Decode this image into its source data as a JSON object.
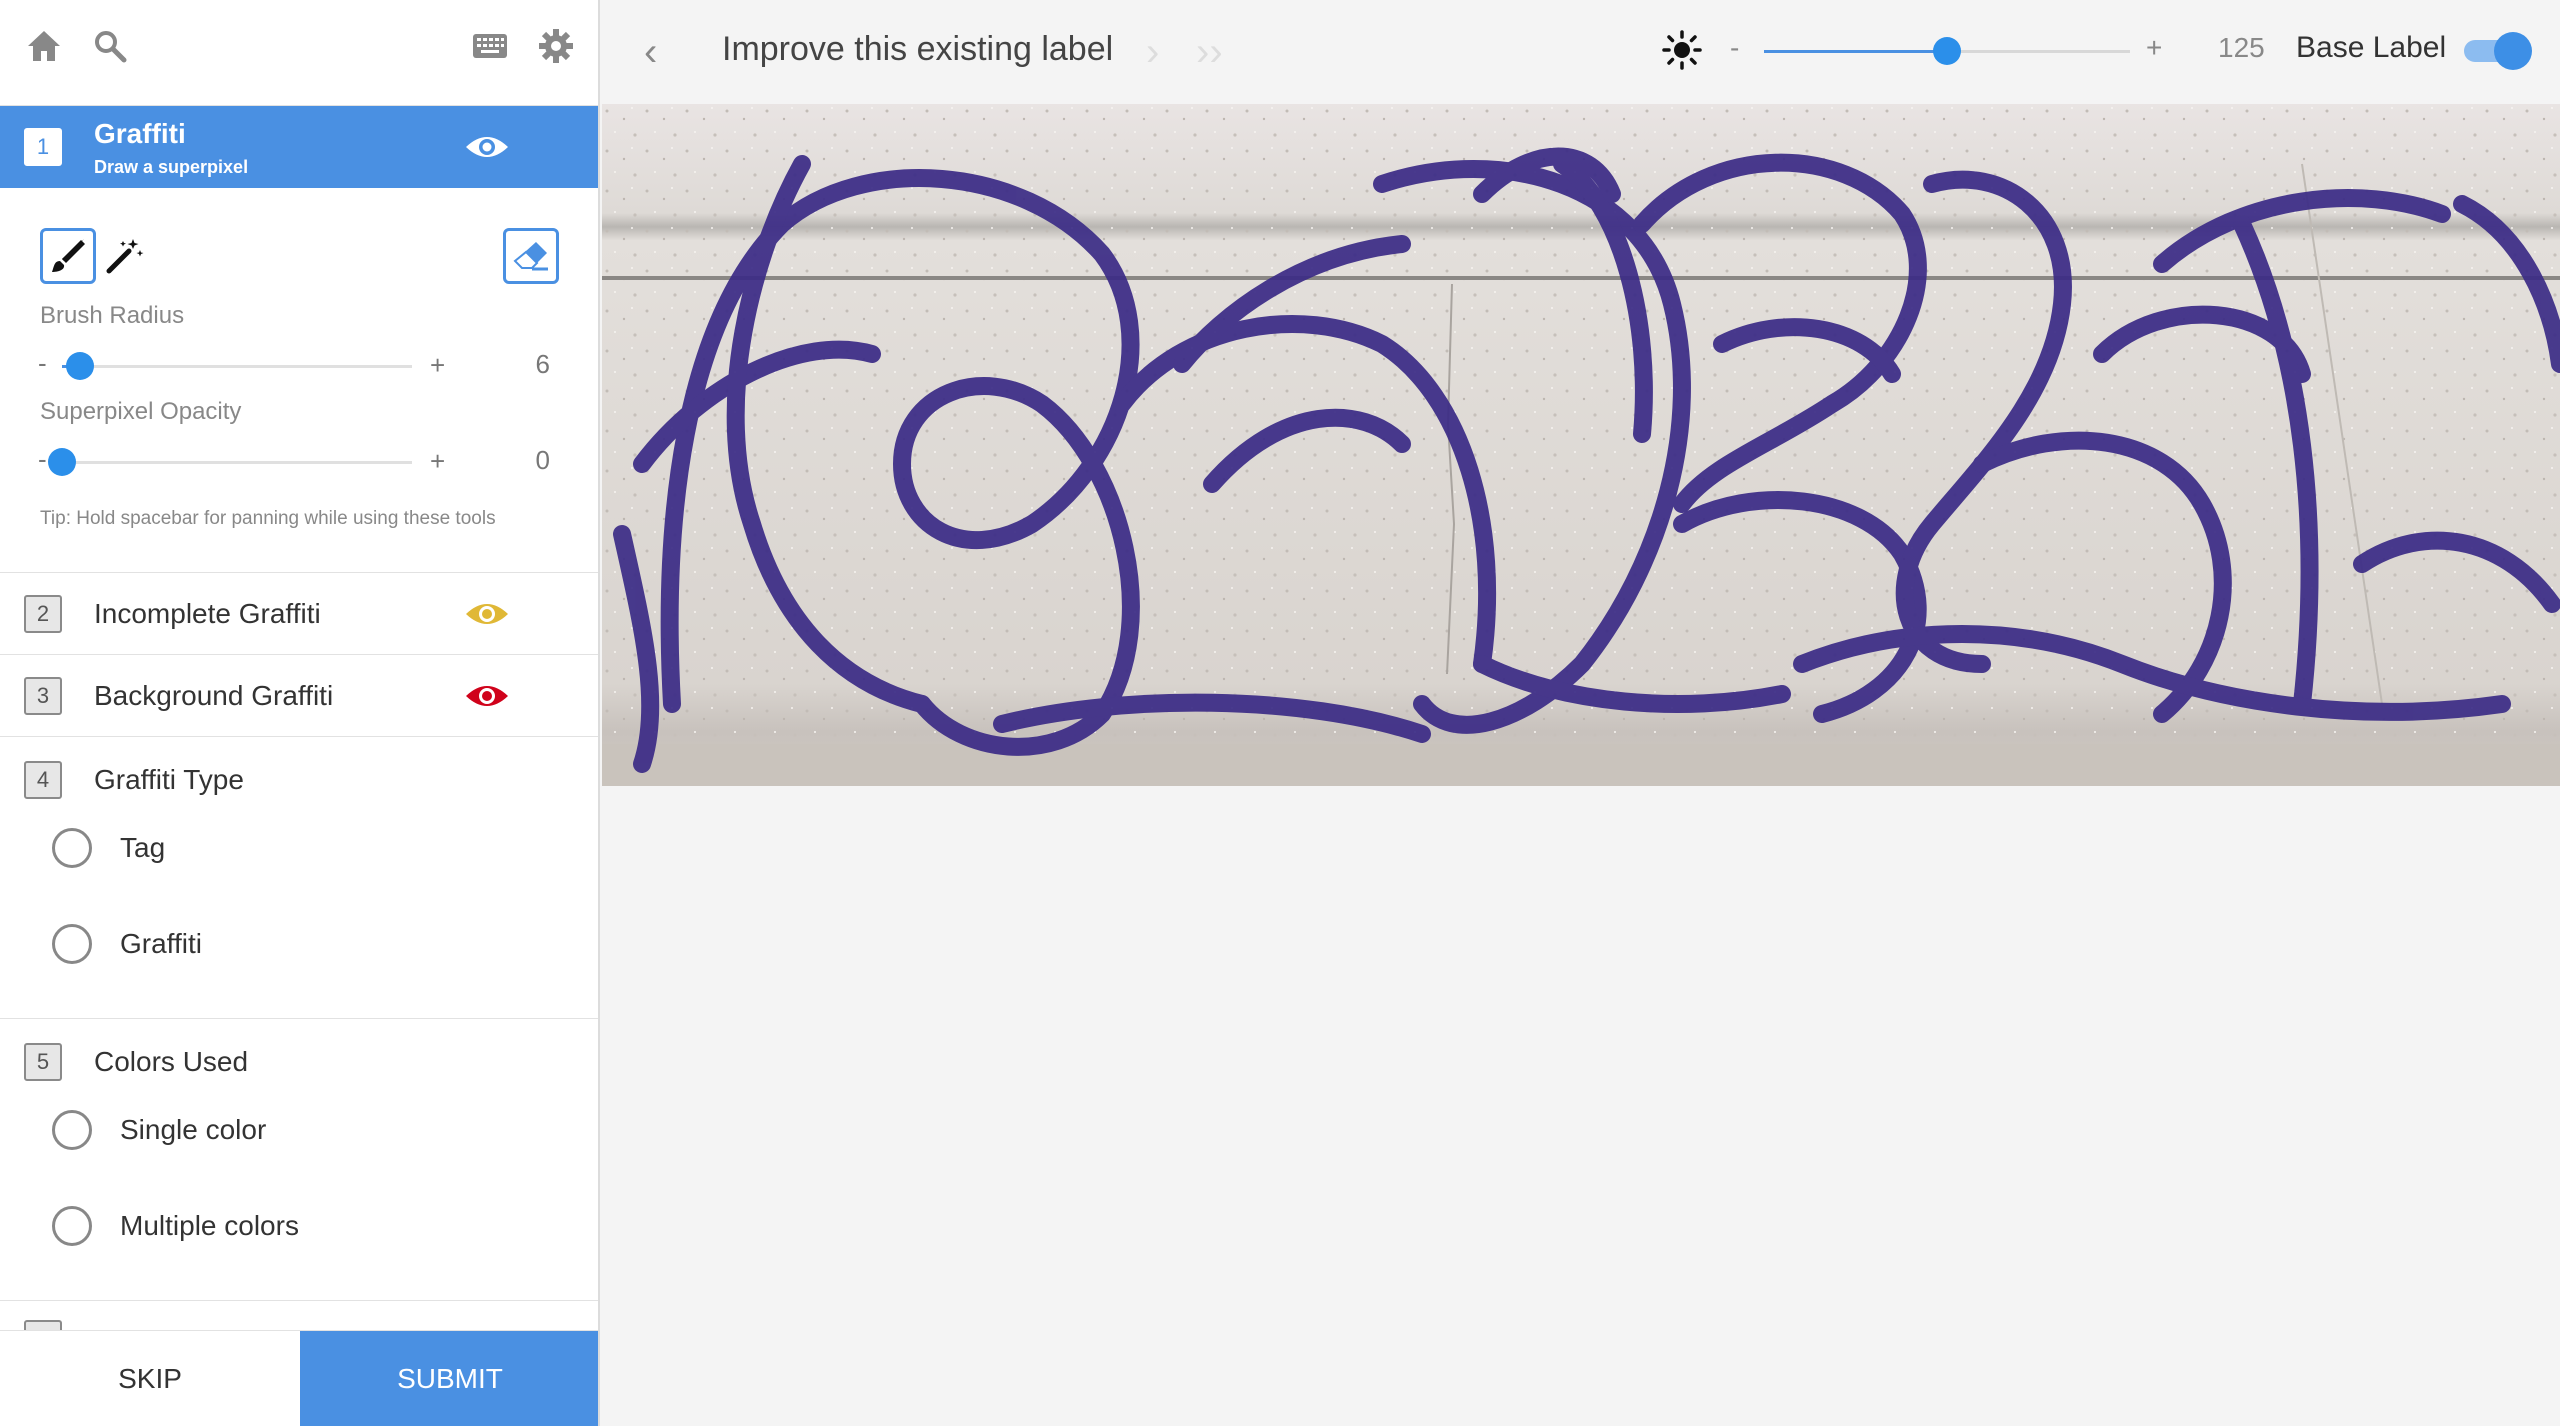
{
  "sidebar": {
    "home_icon": "home-icon",
    "search_icon": "search-icon",
    "keyboard_icon": "keyboard-icon",
    "settings_icon": "gear-icon",
    "active_label": {
      "number": "1",
      "name": "Graffiti",
      "subtitle": "Draw a superpixel",
      "eye_color": "#ffffff"
    },
    "tools": {
      "brush_icon": "brush-icon",
      "wand_icon": "magic-wand-icon",
      "eraser_icon": "eraser-icon",
      "brush_radius": {
        "label": "Brush Radius",
        "minus": "-",
        "plus": "+",
        "value": "6",
        "fraction": 0.05
      },
      "superpixel_opacity": {
        "label": "Superpixel Opacity",
        "minus": "-",
        "plus": "+",
        "value": "0",
        "fraction": 0.0
      },
      "tip": "Tip: Hold spacebar for panning while using these tools"
    },
    "labels": [
      {
        "number": "2",
        "name": "Incomplete Graffiti",
        "eye_color": "#e0b836"
      },
      {
        "number": "3",
        "name": "Background Graffiti",
        "eye_color": "#d0021b"
      }
    ],
    "questions": [
      {
        "number": "4",
        "name": "Graffiti Type",
        "options": [
          "Tag",
          "Graffiti"
        ]
      },
      {
        "number": "5",
        "name": "Colors Used",
        "options": [
          "Single color",
          "Multiple colors"
        ]
      }
    ],
    "footer": {
      "skip": "SKIP",
      "submit": "SUBMIT"
    }
  },
  "topbar": {
    "back_arrow": "‹",
    "title": "Improve this existing label",
    "forward_arrow": "›",
    "fast_forward": "››",
    "brightness_icon": "sun-icon",
    "brightness": {
      "minus": "-",
      "plus": "+",
      "value": "125",
      "fraction": 0.5
    },
    "base_label": "Base Label",
    "base_label_on": true
  },
  "colors": {
    "accent": "#4a90e2",
    "graffiti_ink": "#3b2b86"
  }
}
